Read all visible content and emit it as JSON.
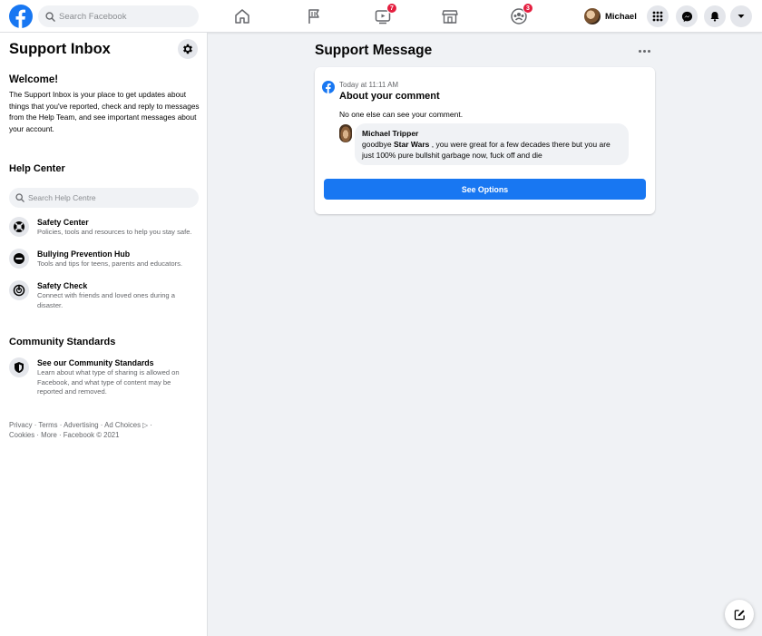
{
  "header": {
    "search_placeholder": "Search Facebook",
    "watch_badge": "7",
    "groups_badge": "3",
    "profile_name": "Michael"
  },
  "sidebar": {
    "title": "Support Inbox",
    "welcome_title": "Welcome!",
    "welcome_text": "The Support Inbox is your place to get updates about things that you've reported, check and reply to messages from the Help Team, and see important messages about your account.",
    "help_center_title": "Help Center",
    "help_search_placeholder": "Search Help Centre",
    "help_items": [
      {
        "title": "Safety Center",
        "desc": "Policies, tools and resources to help you stay safe.",
        "icon": "lifebuoy-icon"
      },
      {
        "title": "Bullying Prevention Hub",
        "desc": "Tools and tips for teens, parents and educators.",
        "icon": "no-entry-icon"
      },
      {
        "title": "Safety Check",
        "desc": "Connect with friends and loved ones during a disaster.",
        "icon": "safety-check-icon"
      }
    ],
    "community_title": "Community Standards",
    "community_item": {
      "title": "See our Community Standards",
      "desc": "Learn about what type of sharing is allowed on Facebook, and what type of content may be reported and removed.",
      "icon": "shield-icon"
    },
    "footer_line1": "Privacy · Terms · Advertising · Ad Choices ▷ ·",
    "footer_line2": "Cookies · More · Facebook © 2021"
  },
  "main": {
    "title": "Support Message",
    "card": {
      "time": "Today at 11:11 AM",
      "subject": "About your comment",
      "note": "No one else can see your comment.",
      "comment_author": "Michael Tripper",
      "comment_pre": "goodbye ",
      "comment_bold": "Star Wars",
      "comment_post": " , you were great for a few decades there but you are just 100% pure bullshit garbage now, fuck off and die",
      "button_label": "See Options"
    }
  },
  "colors": {
    "brand": "#1877f2",
    "badge": "#e41e3f",
    "background": "#f0f2f5"
  }
}
